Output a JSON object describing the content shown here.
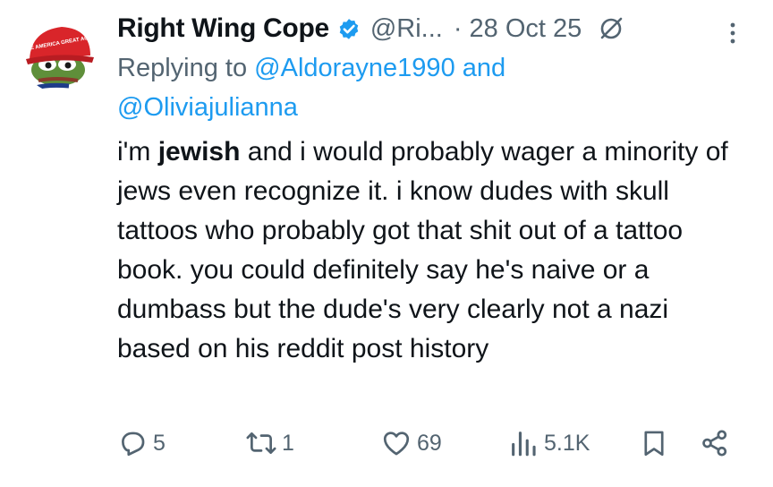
{
  "tweet": {
    "display_name": "Right Wing Cope",
    "handle": "@Ri...",
    "separator": "·",
    "date": "28 Oct 25",
    "reply_prefix": "Replying to",
    "reply_mention_1": "@Aldorayne1990",
    "reply_and": "and",
    "reply_mention_2": "@Oliviajulianna",
    "body_before": "i'm ",
    "body_bold": "jewish",
    "body_after": " and i would probably wager a minority of jews even recognize it. i know dudes with skull tattoos who probably got that shit out of a tattoo book. you could definitely say he's naive or a dumbass but the dude's very clearly not a nazi based on his reddit post history",
    "avatar_hat_text": "MAKE AMERICA GREAT AGAIN"
  },
  "actions": {
    "replies": "5",
    "reposts": "1",
    "likes": "69",
    "views": "5.1K"
  },
  "colors": {
    "text": "#0f1419",
    "secondary": "#536471",
    "link": "#1d9bf0",
    "verified": "#1d9bf0"
  },
  "icons": {
    "verified": "verified-badge-icon",
    "grok": "grok-icon",
    "more": "more-vertical-icon",
    "reply": "reply-icon",
    "repost": "repost-icon",
    "like": "heart-icon",
    "views": "views-icon",
    "bookmark": "bookmark-icon",
    "share": "share-icon"
  }
}
